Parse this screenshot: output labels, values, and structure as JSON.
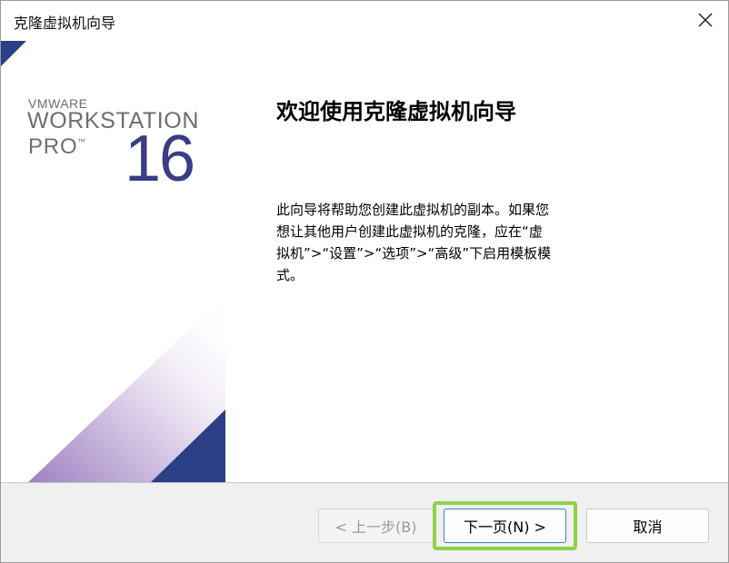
{
  "window": {
    "title": "克隆虚拟机向导",
    "close_symbol": "✕"
  },
  "brand": {
    "vmware": "VMWARE",
    "workstation": "WORKSTATION",
    "pro": "PRO",
    "tm": "™",
    "version": "16"
  },
  "content": {
    "heading": "欢迎使用克隆虚拟机向导",
    "description": "此向导将帮助您创建此虚拟机的副本。如果您想让其他用户创建此虚拟机的克隆，应在“虚拟机”>“设置”>“选项”>“高级”下启用模板模式。"
  },
  "buttons": {
    "back_label": "< 上一步(B)",
    "next_label": "下一页(N) >",
    "cancel_label": "取消"
  },
  "colors": {
    "accent_navy": "#2b3f86",
    "highlight": "#8fd14a",
    "purple_gradient": "#a78bc6"
  }
}
